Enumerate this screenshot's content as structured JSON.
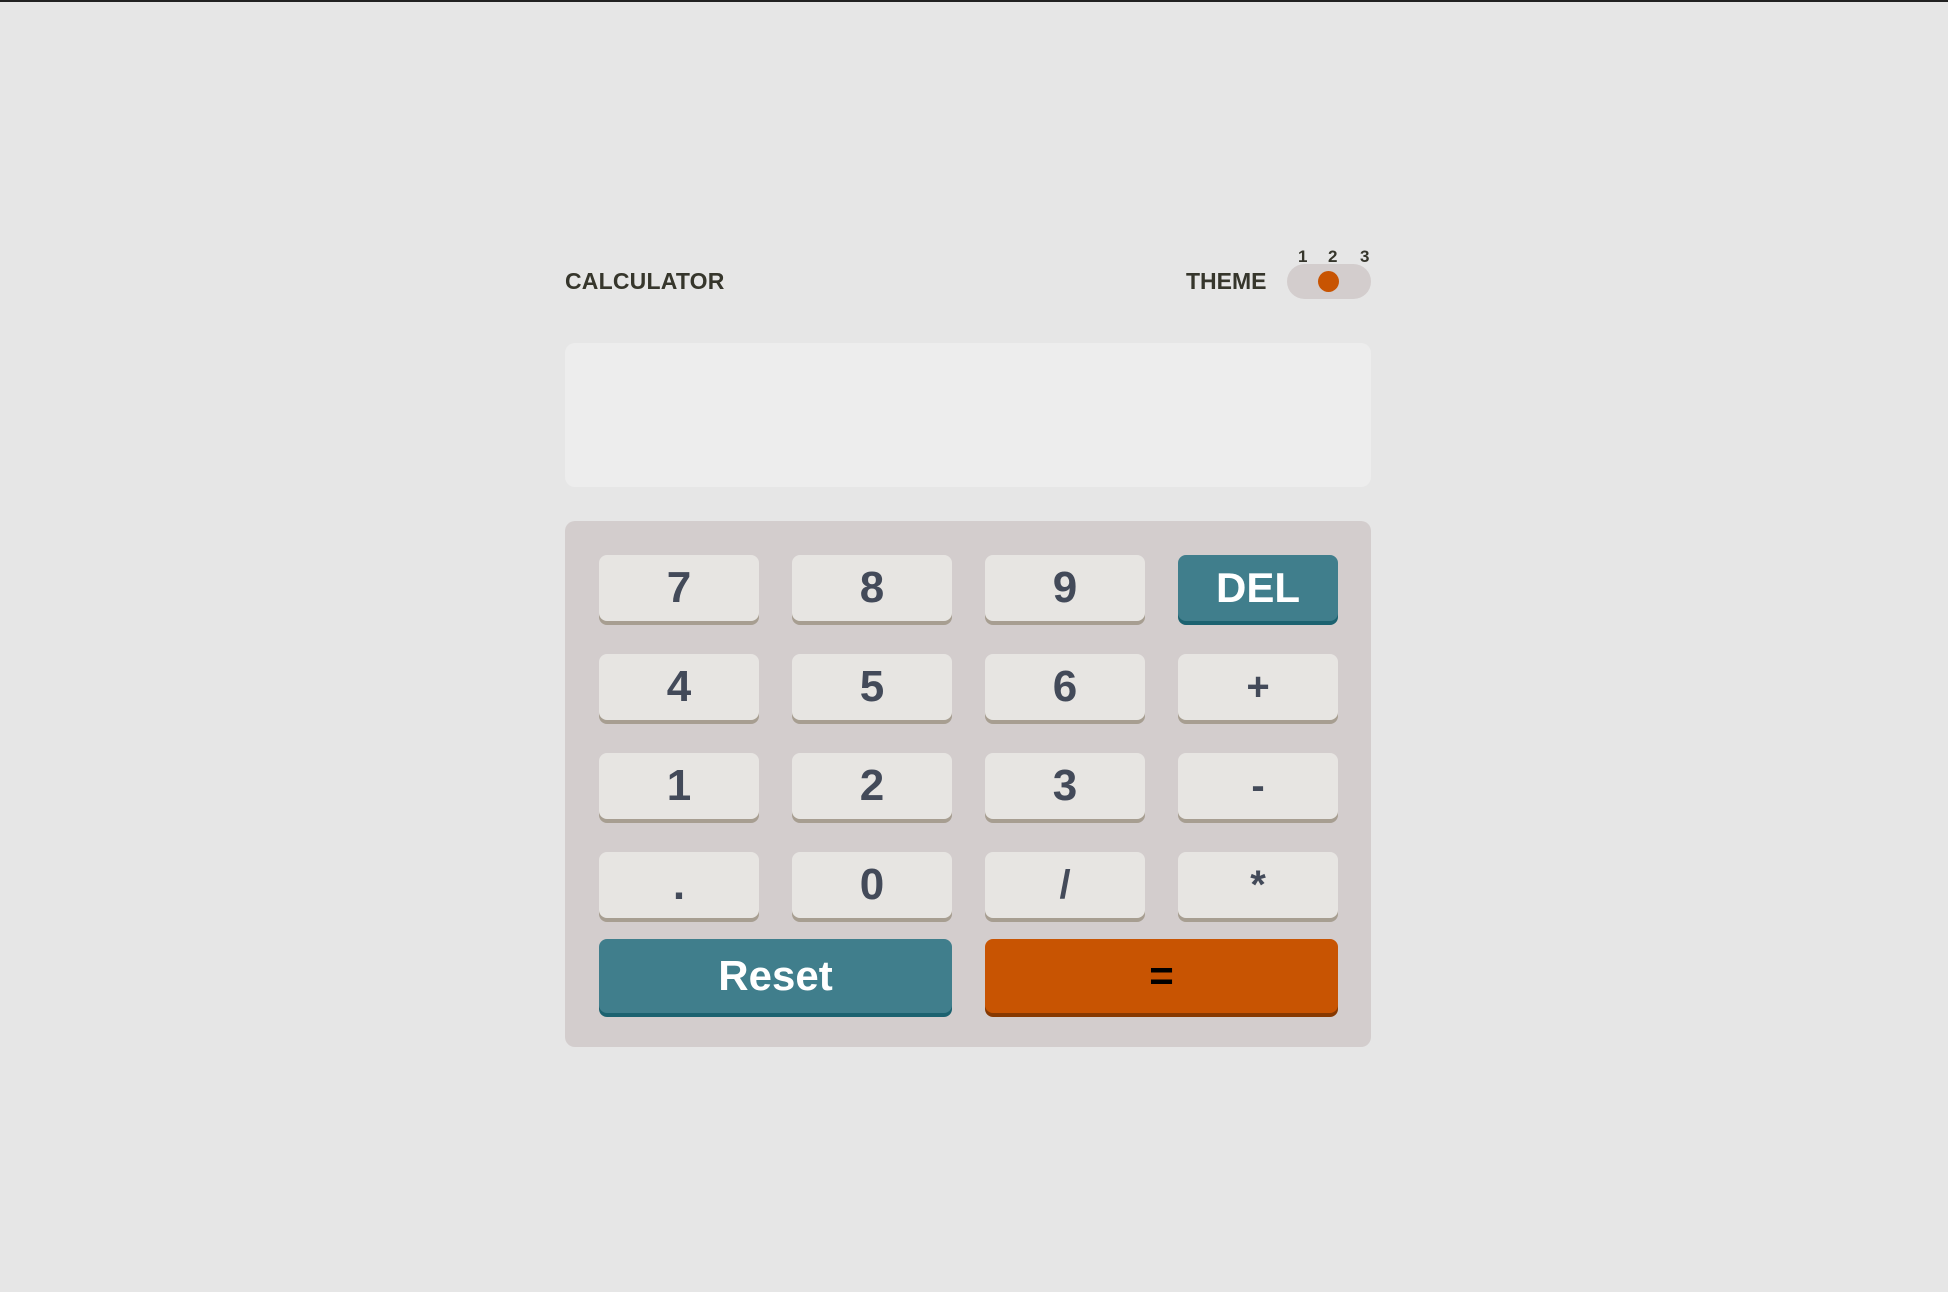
{
  "header": {
    "title": "CALCULATOR",
    "theme_label": "THEME",
    "theme_options": [
      "1",
      "2",
      "3"
    ],
    "theme_selected": "2"
  },
  "display": {
    "value": ""
  },
  "keys": {
    "seven": "7",
    "eight": "8",
    "nine": "9",
    "del": "DEL",
    "four": "4",
    "five": "5",
    "six": "6",
    "plus": "+",
    "one": "1",
    "two": "2",
    "three": "3",
    "minus": "-",
    "decimal": ".",
    "zero": "0",
    "divide": "/",
    "multiply": "*",
    "reset": "Reset",
    "equals": "="
  },
  "colors": {
    "background": "#e6e6e6",
    "keypad_background": "#d3cdcd",
    "screen_background": "#ededed",
    "key_background": "#e7e5e2",
    "key_shadow": "#a79e91",
    "key_text": "#434a59",
    "accent_blue": "#407e8c",
    "accent_orange": "#c85402",
    "heading_text": "#36362c"
  }
}
